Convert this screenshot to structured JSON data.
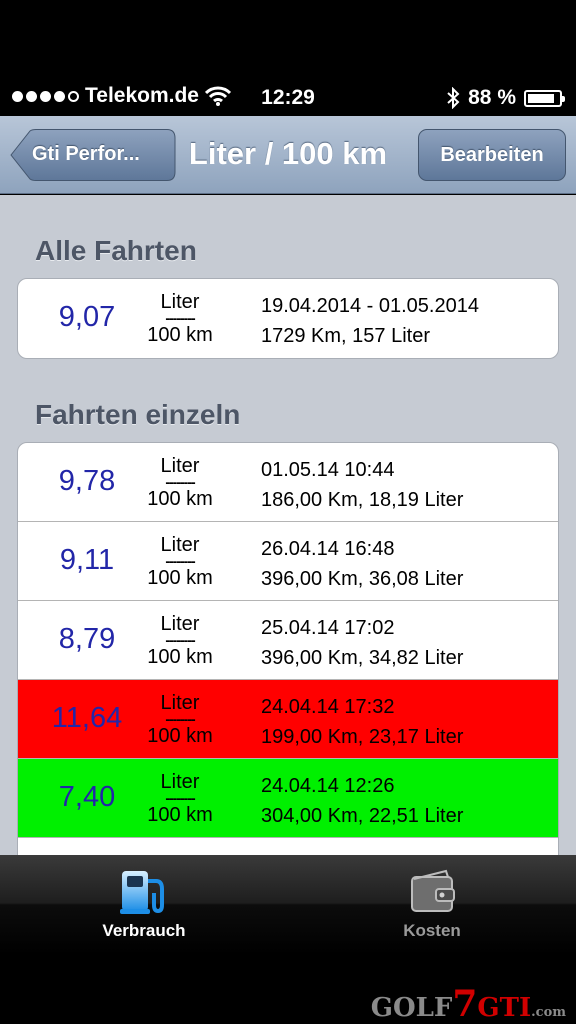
{
  "status_bar": {
    "carrier": "Telekom.de",
    "time": "12:29",
    "battery": "88 %",
    "battery_level": 0.88
  },
  "nav": {
    "back_label": "Gti Perfor...",
    "title": "Liter / 100 km",
    "edit_label": "Bearbeiten"
  },
  "unit": {
    "top": "Liter",
    "dash": "--------",
    "bottom": "100 km"
  },
  "sections": {
    "all": {
      "header": "Alle Fahrten",
      "rows": [
        {
          "value": "9,07",
          "line1": "19.04.2014 - 01.05.2014",
          "line2": "1729 Km, 157 Liter"
        }
      ]
    },
    "single": {
      "header": "Fahrten einzeln",
      "rows": [
        {
          "value": "9,78",
          "line1": "01.05.14 10:44",
          "line2": "186,00 Km, 18,19 Liter"
        },
        {
          "value": "9,11",
          "line1": "26.04.14 16:48",
          "line2": "396,00 Km, 36,08 Liter"
        },
        {
          "value": "8,79",
          "line1": "25.04.14 17:02",
          "line2": "396,00 Km, 34,82 Liter"
        },
        {
          "value": "11,64",
          "line1": "24.04.14 17:32",
          "line2": "199,00 Km, 23,17 Liter",
          "highlight": "red"
        },
        {
          "value": "7,40",
          "line1": "24.04.14 12:26",
          "line2": "304,00 Km, 22,51 Liter",
          "highlight": "green"
        }
      ]
    }
  },
  "tabs": [
    {
      "label": "Verbrauch",
      "icon": "fuel-pump-icon",
      "active": true
    },
    {
      "label": "Kosten",
      "icon": "wallet-icon",
      "active": false
    }
  ],
  "watermark": {
    "golf": "GOLF",
    "seven": "7",
    "gti": "GTI",
    "com": ".com"
  },
  "colors": {
    "value_blue": "#2226a8",
    "red_row": "#ff0000",
    "green_row": "#00f000"
  }
}
